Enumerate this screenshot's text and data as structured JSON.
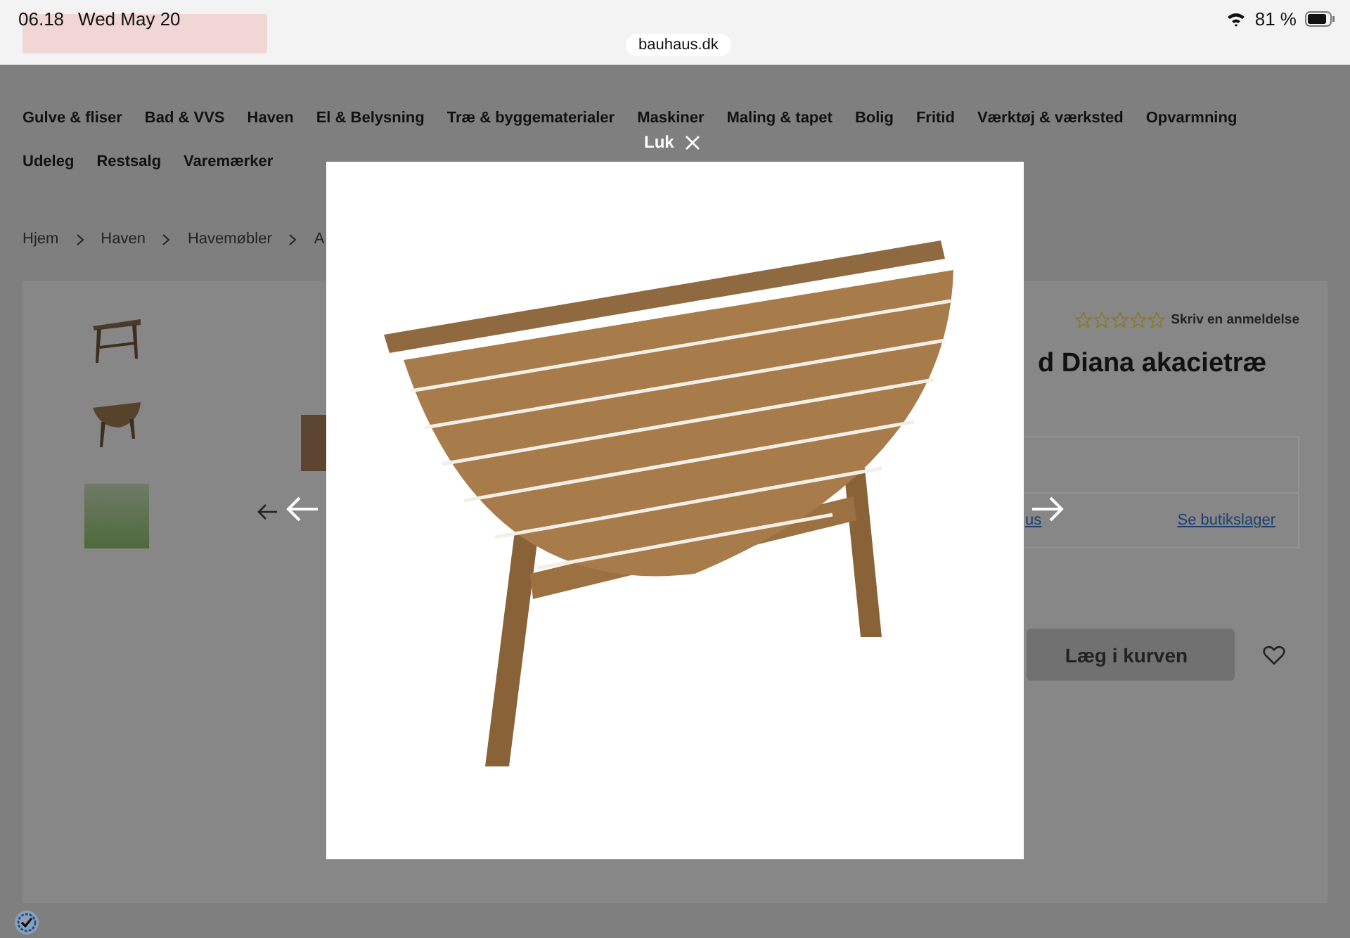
{
  "status_bar": {
    "time": "06.18",
    "date": "Wed May 20",
    "url": "bauhaus.dk",
    "battery": "81 %"
  },
  "nav": {
    "rows": [
      [
        "Gulve & fliser",
        "Bad & VVS",
        "Haven",
        "El & Belysning",
        "Træ & byggematerialer",
        "Maskiner",
        "Maling & tapet",
        "Bolig",
        "Fritid",
        "Værktøj & værksted",
        "Opvarmning"
      ],
      [
        "Udeleg",
        "Restsalg",
        "Varemærker"
      ]
    ]
  },
  "breadcrumbs": [
    "Hjem",
    "Haven",
    "Havemøbler",
    "A"
  ],
  "product": {
    "rating": {
      "stars": 0,
      "link": "Skriv en anmeldelse"
    },
    "title": "d Diana akacietræ",
    "store_link_partial": "us",
    "store_link": "Se butikslager",
    "add_to_cart": "Læg i kurven"
  },
  "lightbox": {
    "close_label": "Luk"
  }
}
